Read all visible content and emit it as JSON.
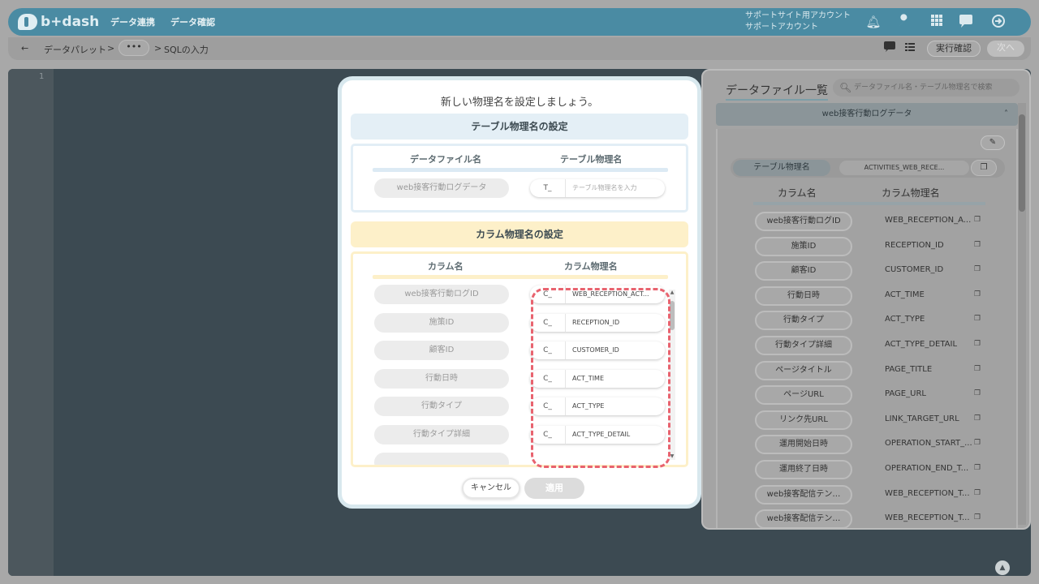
{
  "header": {
    "logo_text": "b+dash",
    "nav": [
      "データ連携",
      "データ確認"
    ],
    "account_line1": "サポートサイト用アカウント",
    "account_line2": "サポートアカウント",
    "icons": [
      "bell-icon",
      "wrench-icon",
      "grid-icon",
      "chat-icon",
      "logout-icon"
    ]
  },
  "breadcrumb": {
    "back_glyph": "←",
    "item1": "データパレット",
    "sep": ">",
    "ellipsis": "•••",
    "item3": "SQLの入力",
    "run_label": "実行確認",
    "next_label": "次へ"
  },
  "editor": {
    "line_number": "1"
  },
  "side_panel": {
    "title": "データファイル一覧",
    "search_placeholder": "データファイル名・テーブル物理名で検索",
    "file_name": "web接客行動ログデータ",
    "table_label": "テーブル物理名",
    "table_value": "ACTIVITIES_WEB_RECE...",
    "col_head_name": "カラム名",
    "col_head_phys": "カラム物理名",
    "rows": [
      {
        "name": "web接客行動ログID",
        "phys": "WEB_RECEPTION_A..."
      },
      {
        "name": "施策ID",
        "phys": "RECEPTION_ID"
      },
      {
        "name": "顧客ID",
        "phys": "CUSTOMER_ID"
      },
      {
        "name": "行動日時",
        "phys": "ACT_TIME"
      },
      {
        "name": "行動タイプ",
        "phys": "ACT_TYPE"
      },
      {
        "name": "行動タイプ詳細",
        "phys": "ACT_TYPE_DETAIL"
      },
      {
        "name": "ページタイトル",
        "phys": "PAGE_TITLE"
      },
      {
        "name": "ページURL",
        "phys": "PAGE_URL"
      },
      {
        "name": "リンク先URL",
        "phys": "LINK_TARGET_URL"
      },
      {
        "name": "運用開始日時",
        "phys": "OPERATION_START_..."
      },
      {
        "name": "運用終了日時",
        "phys": "OPERATION_END_T..."
      },
      {
        "name": "web接客配信テン…",
        "phys": "WEB_RECEPTION_T..."
      },
      {
        "name": "web接客配信テン…",
        "phys": "WEB_RECEPTION_T..."
      }
    ]
  },
  "modal": {
    "title": "新しい物理名を設定しましょう。",
    "table_section": {
      "header": "テーブル物理名の設定",
      "col_file": "データファイル名",
      "col_phys": "テーブル物理名",
      "file_name": "web接客行動ログデータ",
      "prefix": "T_",
      "placeholder": "テーブル物理名を入力"
    },
    "column_section": {
      "header": "カラム物理名の設定",
      "col_name": "カラム名",
      "col_phys": "カラム物理名",
      "prefix": "C_",
      "rows": [
        {
          "name": "web接客行動ログID",
          "value": "WEB_RECEPTION_ACT..."
        },
        {
          "name": "施策ID",
          "value": "RECEPTION_ID"
        },
        {
          "name": "顧客ID",
          "value": "CUSTOMER_ID"
        },
        {
          "name": "行動日時",
          "value": "ACT_TIME"
        },
        {
          "name": "行動タイプ",
          "value": "ACT_TYPE"
        },
        {
          "name": "行動タイプ詳細",
          "value": "ACT_TYPE_DETAIL"
        }
      ]
    },
    "cancel_label": "キャンセル",
    "apply_label": "適用"
  },
  "colors": {
    "highlight_dash": "#e8636f",
    "blue_section": "#e4eff6",
    "yellow_section": "#fdf0c9"
  }
}
